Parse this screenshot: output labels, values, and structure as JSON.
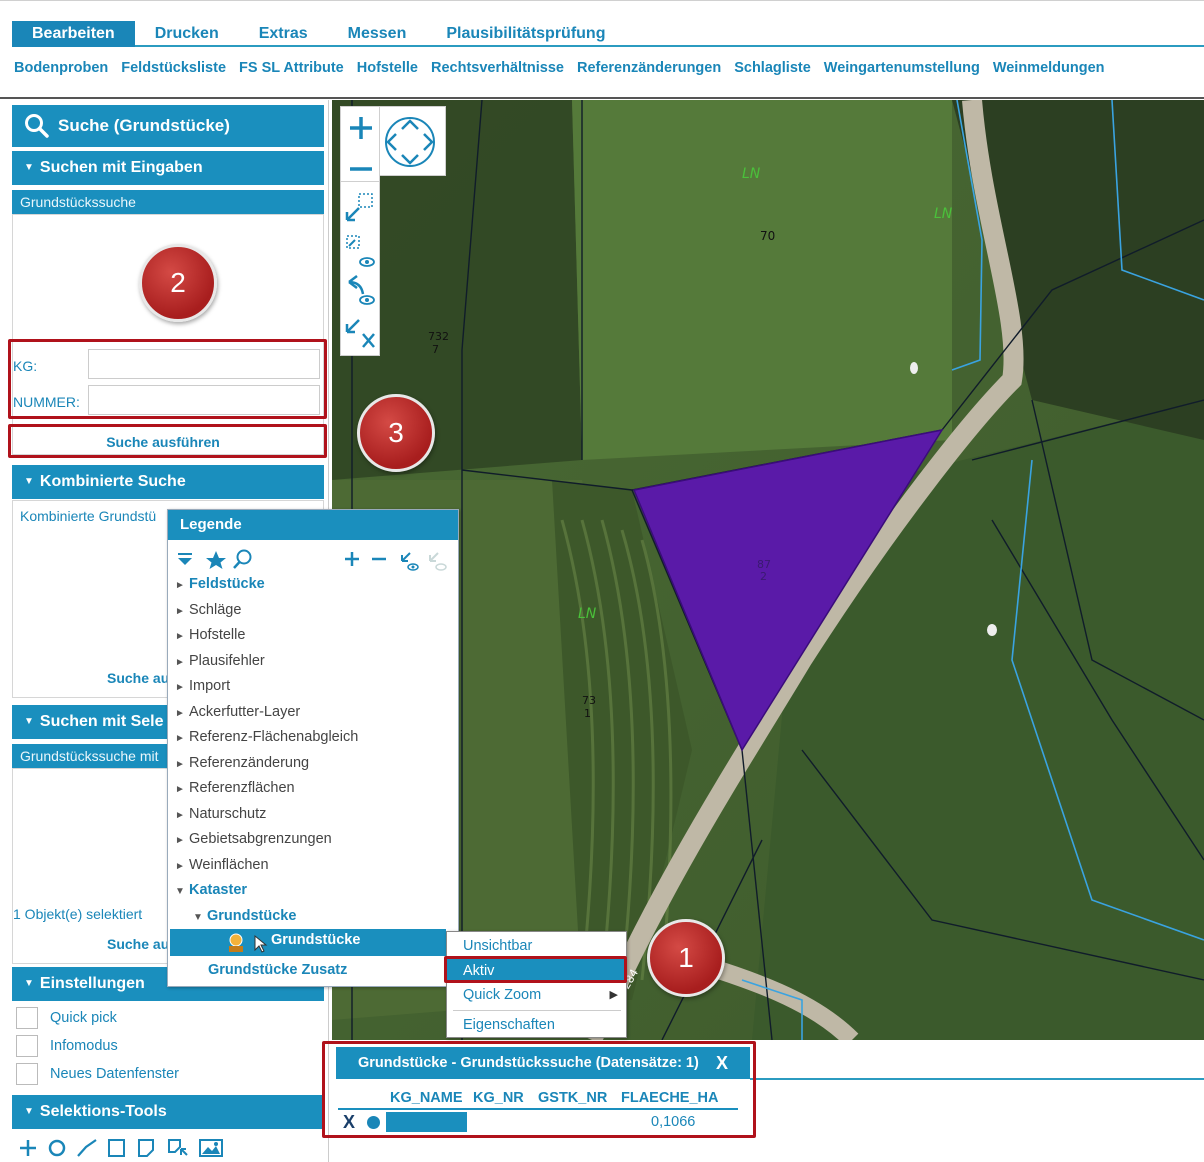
{
  "menu": {
    "tabs": [
      {
        "label": "Bearbeiten",
        "active": true
      },
      {
        "label": "Drucken"
      },
      {
        "label": "Extras"
      },
      {
        "label": "Messen"
      },
      {
        "label": "Plausibilitätsprüfung"
      }
    ],
    "submenu": [
      "Bodenproben",
      "Feldstücksliste",
      "FS SL Attribute",
      "Hofstelle",
      "Rechtsverhältnisse",
      "Referenzänderungen",
      "Schlagliste",
      "Weingartenumstellung",
      "Weinmeldungen"
    ]
  },
  "search_panel": {
    "title": "Suche  (Grundstücke)",
    "section_input": {
      "header": "Suchen mit Eingaben",
      "subheader": "Grundstückssuche",
      "kg_label": "KG:",
      "nummer_label": "NUMMER:",
      "kg_value": "",
      "nummer_value": "",
      "execute": "Suche ausführen"
    },
    "section_combined": {
      "header": "Kombinierte Suche",
      "subheader": "Kombinierte Grundstü",
      "execute": "Suche au"
    },
    "section_selection": {
      "header": "Suchen mit Sele",
      "subheader": "Grundstückssuche mit",
      "status": "1 Objekt(e) selektiert",
      "execute": "Suche au"
    },
    "section_settings": {
      "header": "Einstellungen",
      "options": [
        "Quick pick",
        "Infomodus",
        "Neues Datenfenster"
      ]
    },
    "section_tools": {
      "header": "Selektions-Tools"
    }
  },
  "map": {
    "labels": [
      "LN",
      "LN",
      "70",
      "732",
      "7",
      "LN",
      "73",
      "1",
      "87",
      "2",
      "284"
    ],
    "selected_color": "#5a1aa8"
  },
  "legend": {
    "title": "Legende",
    "items": [
      {
        "label": "Feldstücke",
        "group": true,
        "expanded": false
      },
      {
        "label": "Schläge"
      },
      {
        "label": "Hofstelle"
      },
      {
        "label": "Plausifehler"
      },
      {
        "label": "Import"
      },
      {
        "label": "Ackerfutter-Layer"
      },
      {
        "label": "Referenz-Flächenabgleich"
      },
      {
        "label": "Referenzänderung"
      },
      {
        "label": "Referenzflächen"
      },
      {
        "label": "Naturschutz"
      },
      {
        "label": "Gebietsabgrenzungen"
      },
      {
        "label": "Weinflächen"
      },
      {
        "label": "Kataster",
        "group": true,
        "expanded": true
      },
      {
        "label": "Grundstücke",
        "group": true,
        "expanded": true,
        "indent": 1
      },
      {
        "label": "Grundstücke",
        "selected": true,
        "indent": 2
      },
      {
        "label": "Grundstücke Zusatz",
        "group": true,
        "indent": 1
      }
    ]
  },
  "context_menu": {
    "items": [
      "Unsichtbar",
      "Aktiv",
      "Quick Zoom",
      "Eigenschaften"
    ],
    "active": "Aktiv"
  },
  "result": {
    "title": "Grundstücke - Grundstückssuche (Datensätze: 1)",
    "close": "X",
    "columns": [
      "KG_NAME",
      "KG_NR",
      "GSTK_NR",
      "FLAECHE_HA"
    ],
    "rows": [
      {
        "delete": "X",
        "flaeche_ha": "0,1066"
      }
    ]
  },
  "callouts": [
    "2",
    "3",
    "1"
  ],
  "colors": {
    "accent": "#1a8fbe",
    "link": "#1a86b8",
    "highlight": "#b0121b",
    "badge": "#a81e1e"
  }
}
